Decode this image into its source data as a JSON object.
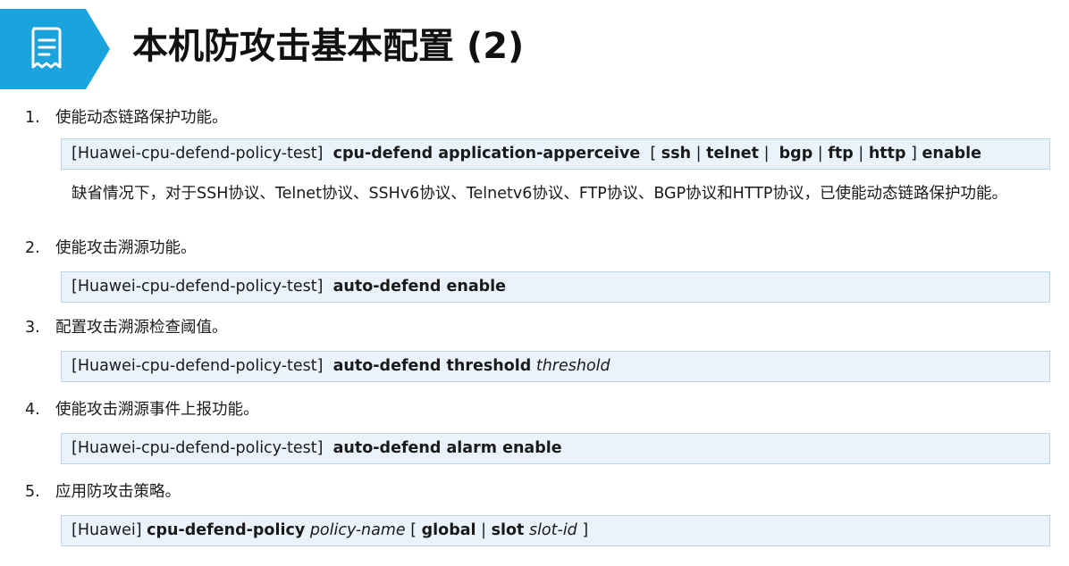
{
  "header": {
    "title": "本机防攻击基本配置 (2)",
    "icon": "document-list-icon",
    "accent_color": "#1aa3dd"
  },
  "steps": [
    {
      "number": "1.",
      "label": "使能动态链路保护功能。",
      "command": {
        "view": "[Huawei-cpu-defend-policy-test]",
        "keyword": "cpu-defend application-apperceive",
        "bracket_open": "[",
        "opt_ssh": "ssh",
        "opt_telnet": "telnet",
        "opt_bgp": "bgp",
        "opt_ftp": "ftp",
        "opt_http": "http",
        "bracket_close": "]",
        "tail_keyword": "enable"
      },
      "note": "缺省情况下，对于SSH协议、Telnet协议、SSHv6协议、Telnetv6协议、FTP协议、BGP协议和HTTP协议，已使能动态链路保护功能。"
    },
    {
      "number": "2.",
      "label": "使能攻击溯源功能。",
      "command": {
        "view": "[Huawei-cpu-defend-policy-test]",
        "keyword": "auto-defend enable"
      }
    },
    {
      "number": "3.",
      "label": "配置攻击溯源检查阈值。",
      "command": {
        "view": "[Huawei-cpu-defend-policy-test]",
        "keyword": "auto-defend threshold",
        "param": "threshold"
      }
    },
    {
      "number": "4.",
      "label": "使能攻击溯源事件上报功能。",
      "command": {
        "view": "[Huawei-cpu-defend-policy-test]",
        "keyword": "auto-defend alarm enable"
      }
    },
    {
      "number": "5.",
      "label": "应用防攻击策略。",
      "command": {
        "view": "[Huawei]",
        "keyword": "cpu-defend-policy",
        "param": "policy-name",
        "bracket_open": "[",
        "opt_global": "global",
        "opt_slot": "slot",
        "param_slot": "slot-id",
        "bracket_close": "]"
      }
    }
  ]
}
